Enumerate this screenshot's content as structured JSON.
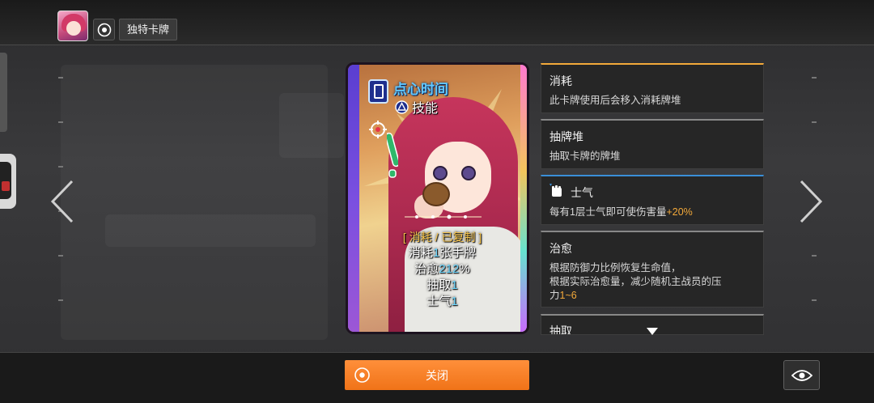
{
  "header": {
    "tag_label": "独特卡牌",
    "tag_icon": "target-circle-icon"
  },
  "card": {
    "name": "点心时间",
    "type": "技能",
    "keywords": "[ 消耗 / 已复制 ]",
    "lines": [
      {
        "prefix": "消耗",
        "num": "1",
        "suffix": "张手牌"
      },
      {
        "prefix": "治愈",
        "num": "212",
        "suffix": "%"
      },
      {
        "prefix": "抽取",
        "num": "1",
        "suffix": ""
      },
      {
        "prefix": "士气",
        "num": "1",
        "suffix": ""
      }
    ]
  },
  "keywords_panel": [
    {
      "title": "消耗",
      "desc": "此卡牌使用后会移入消耗牌堆"
    },
    {
      "title": "抽牌堆",
      "desc": "抽取卡牌的牌堆"
    },
    {
      "title": "士气",
      "desc_prefix": "每有1层士气即可使伤害量",
      "desc_hl": "+20%",
      "desc_suffix": "",
      "icon": "fist-icon"
    },
    {
      "title": "治愈",
      "desc_line1": "根据防御力比例恢复生命值，",
      "desc_line2": "根据实际治愈量，减少随机主战员的压",
      "desc_line3_prefix": "力",
      "desc_line3_hl": "1~6"
    },
    {
      "title": "抽取"
    }
  ],
  "footer": {
    "close_label": "关闭"
  },
  "colors": {
    "accent": "#f07318",
    "highlight": "#f3a93a",
    "card_name": "#62c8ff"
  }
}
